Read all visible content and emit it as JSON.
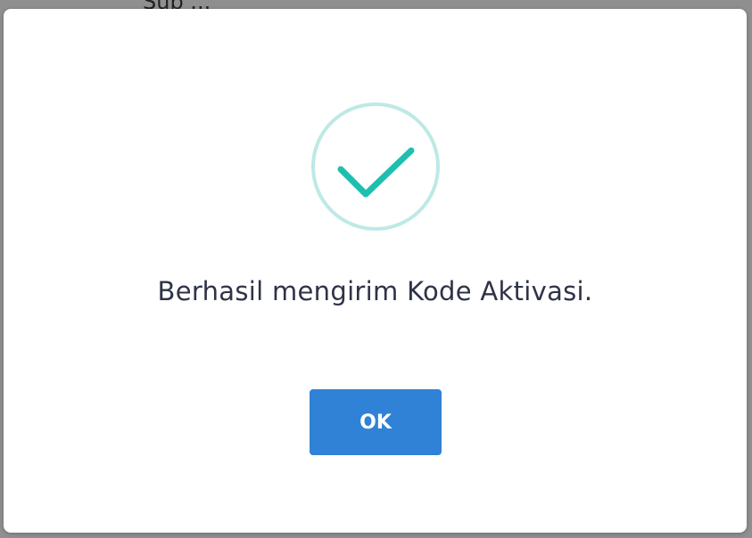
{
  "background": {
    "partial_text": "Sub ..."
  },
  "dialog": {
    "icon": "checkmark-success-icon",
    "message": "Berhasil mengirim Kode Aktivasi.",
    "ok_label": "OK"
  },
  "colors": {
    "accent": "#3082d6",
    "success": "#1fbfb0",
    "success_ring": "#bde9e6",
    "text": "#2e3347"
  }
}
